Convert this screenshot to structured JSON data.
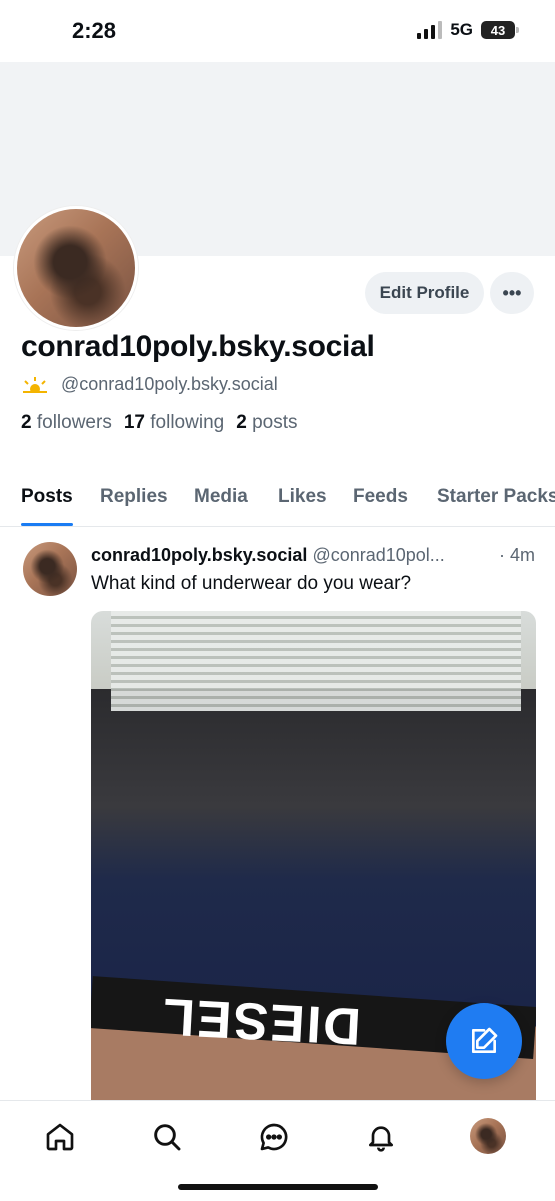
{
  "status_bar": {
    "time": "2:28",
    "network": "5G",
    "battery": "43"
  },
  "profile": {
    "display_name": "conrad10poly.bsky.social",
    "handle": "@conrad10poly.bsky.social",
    "followers_count": "2",
    "followers_label": "followers",
    "following_count": "17",
    "following_label": "following",
    "posts_count": "2",
    "posts_label": "posts",
    "edit_label": "Edit Profile",
    "more_label": "•••"
  },
  "tabs": [
    "Posts",
    "Replies",
    "Media",
    "Likes",
    "Feeds",
    "Starter Packs"
  ],
  "post": {
    "author": "conrad10poly.bsky.social",
    "handle": "@conrad10pol...",
    "time": "· 4m",
    "text": "What kind of underwear do you wear?",
    "image_text": "DIESEL"
  },
  "icons": {
    "home": "home-icon",
    "search": "search-icon",
    "chat": "chat-icon",
    "bell": "bell-icon",
    "compose": "compose-icon"
  },
  "colors": {
    "accent": "#1f7cf2",
    "muted": "#5b6672"
  }
}
